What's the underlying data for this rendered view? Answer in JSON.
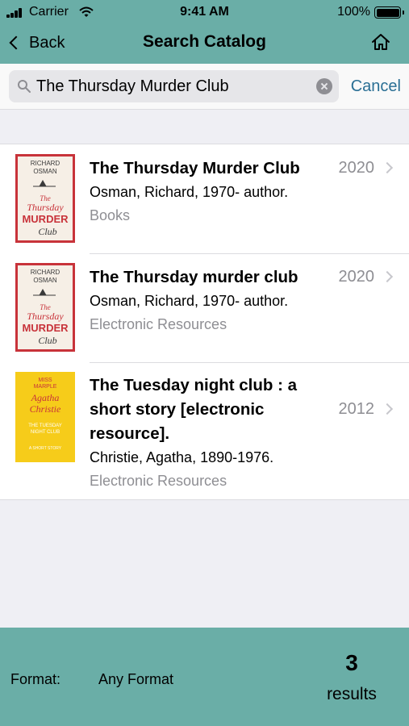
{
  "status": {
    "carrier": "Carrier",
    "time": "9:41 AM",
    "battery": "100%"
  },
  "nav": {
    "back_label": "Back",
    "title": "Search Catalog",
    "home_icon": "home-icon"
  },
  "search": {
    "query": "The Thursday Murder Club",
    "cancel_label": "Cancel"
  },
  "results": [
    {
      "title": "The Thursday Murder Club",
      "author": "Osman, Richard, 1970- author.",
      "format": "Books",
      "year": "2020",
      "cover": {
        "line1": "RICHARD",
        "line2": "OSMAN",
        "line3": "The",
        "line4": "Thursday",
        "line5": "MURDER",
        "line6": "Club"
      }
    },
    {
      "title": "The Thursday murder club",
      "author": "Osman, Richard, 1970- author.",
      "format": "Electronic Resources",
      "year": "2020",
      "cover": {
        "line1": "RICHARD",
        "line2": "OSMAN",
        "line3": "The",
        "line4": "Thursday",
        "line5": "MURDER",
        "line6": "Club"
      }
    },
    {
      "title_line1": "The Tuesday night club : a",
      "title_line2": "short story [electronic",
      "title_line3": "resource].",
      "author": "Christie, Agatha, 1890-1976.",
      "format": "Electronic Resources",
      "year": "2012",
      "cover": {
        "line1": "MISS",
        "line2": "MARPLE",
        "line3": "Agatha",
        "line4": "Christie",
        "line5": "THE TUESDAY",
        "line6": "NIGHT CLUB",
        "line7": "A SHORT STORY"
      }
    }
  ],
  "footer": {
    "format_label": "Format:",
    "format_value": "Any Format",
    "count": "3",
    "count_label": "results"
  },
  "colors": {
    "bar": "#6aaea7",
    "link": "#2a6f94",
    "cover_red": "#c8333a",
    "cover_yellow": "#f6cc1a"
  }
}
